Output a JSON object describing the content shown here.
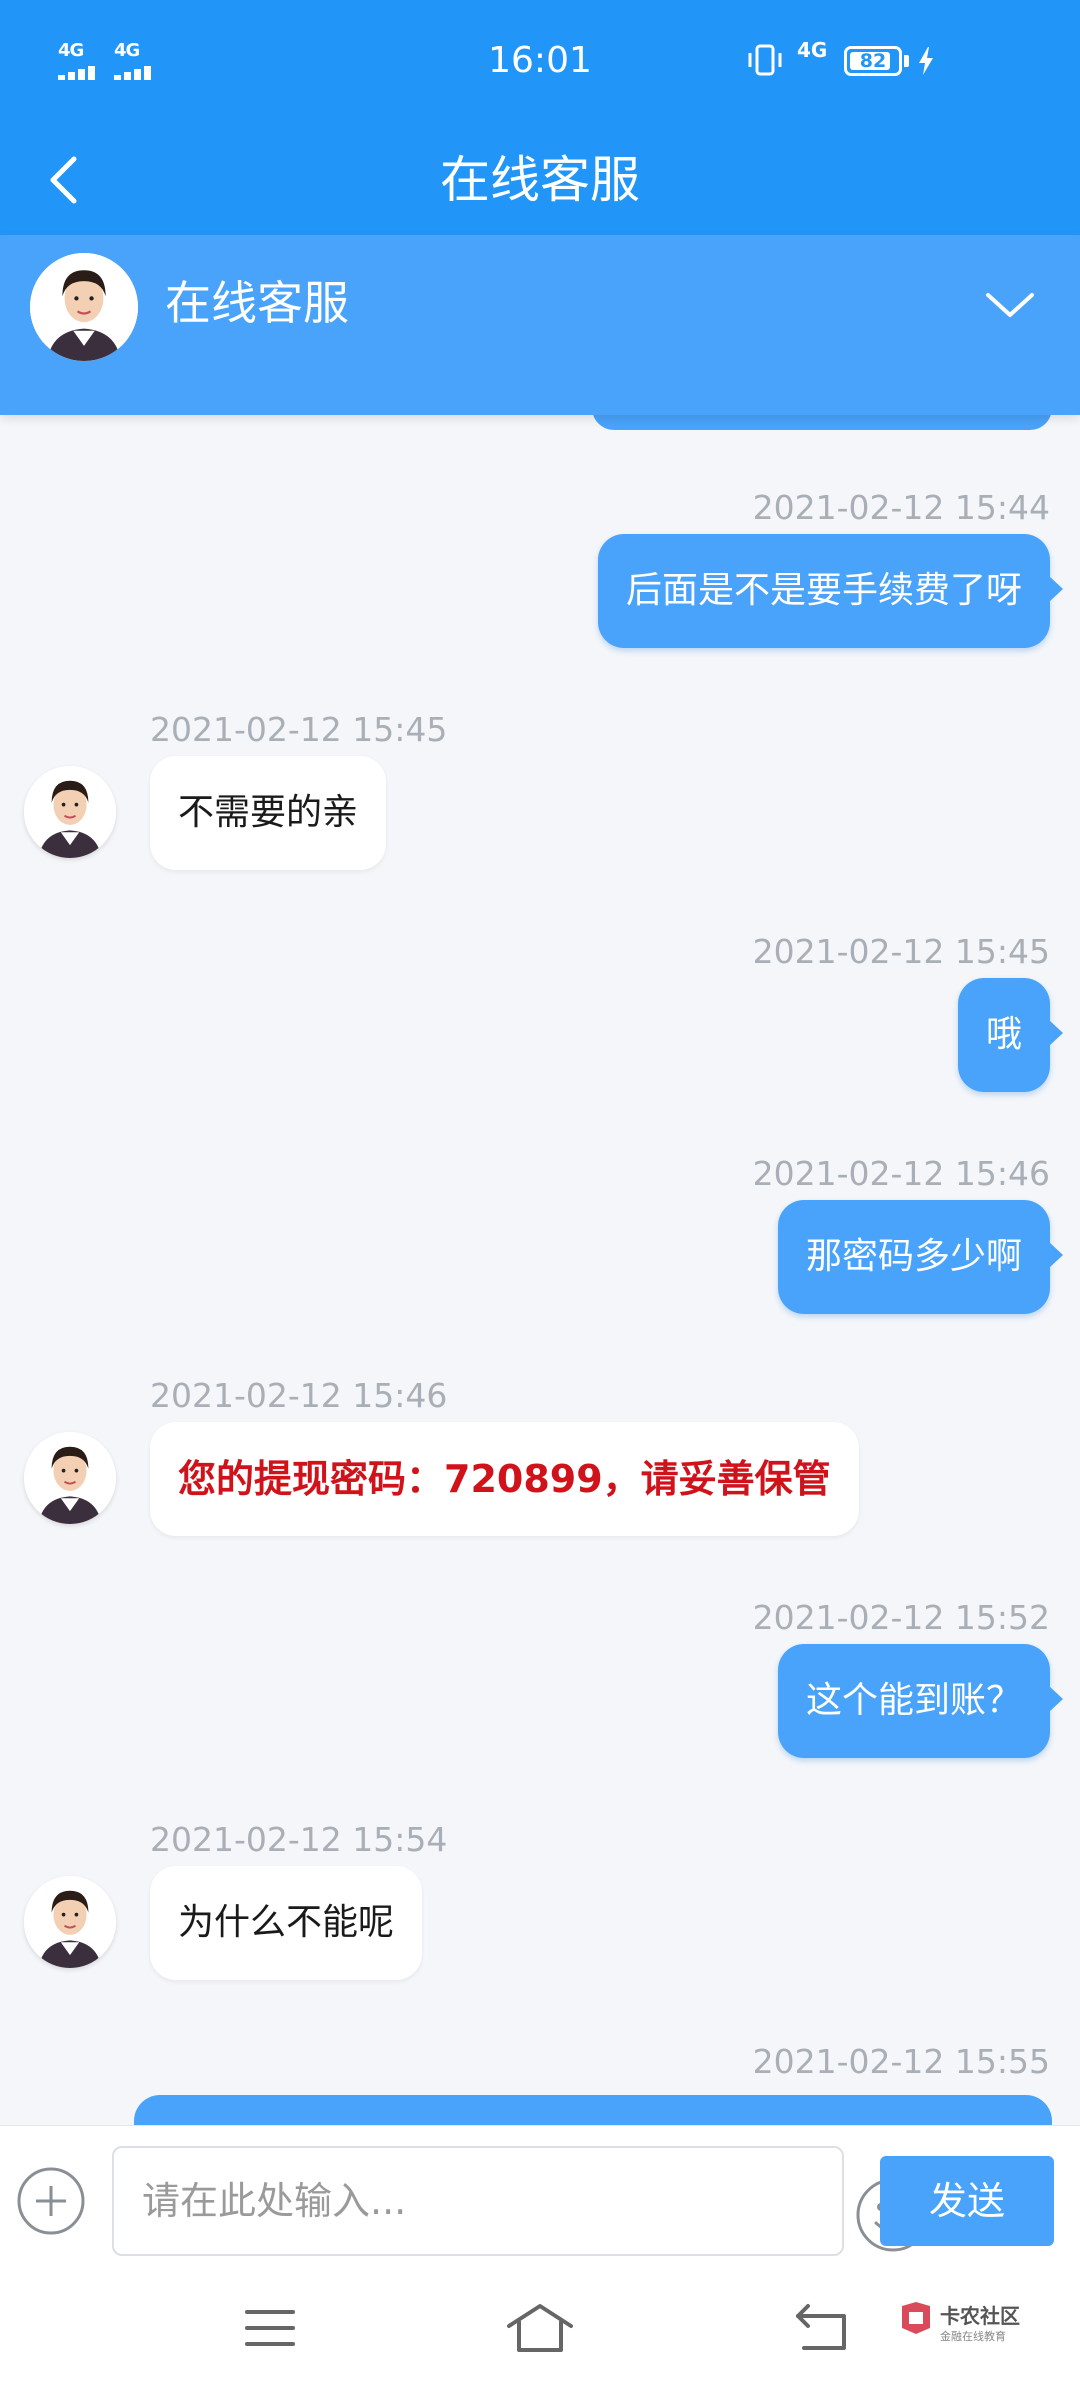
{
  "status_bar": {
    "time": "16:01",
    "sim1_network": "4G",
    "sim2_network": "4G",
    "right_network": "4G",
    "battery_level": "82",
    "icons": [
      "signal-icon",
      "vibrate-icon",
      "battery-icon",
      "charging-icon"
    ]
  },
  "header": {
    "title": "在线客服",
    "back_icon": "back-arrow-icon"
  },
  "agent": {
    "name": "在线客服",
    "expand_icon": "chevron-down-icon"
  },
  "messages": [
    {
      "side": "out",
      "time": "2021-02-12 15:44",
      "text": "后面是不是要手续费了呀"
    },
    {
      "side": "in",
      "time": "2021-02-12 15:45",
      "text": "不需要的亲"
    },
    {
      "side": "out",
      "time": "2021-02-12 15:45",
      "text": "哦"
    },
    {
      "side": "out",
      "time": "2021-02-12 15:46",
      "text": "那密码多少啊"
    },
    {
      "side": "in",
      "time": "2021-02-12 15:46",
      "text": "您的提现密码：720899，请妥善保管",
      "highlight": true
    },
    {
      "side": "out",
      "time": "2021-02-12 15:52",
      "text": "这个能到账？"
    },
    {
      "side": "in",
      "time": "2021-02-12 15:54",
      "text": "为什么不能呢"
    },
    {
      "side": "out",
      "time": "2021-02-12 15:55",
      "text": ""
    }
  ],
  "composer": {
    "placeholder": "请在此处输入...",
    "send_label": "发送",
    "plus_icon": "plus-circle-icon",
    "emoji_icon": "smiley-icon"
  },
  "nav": {
    "icons": [
      "menu-icon",
      "home-icon",
      "back-icon"
    ]
  },
  "watermark": {
    "title": "卡农社区",
    "subtitle": "金融在线教育"
  },
  "colors": {
    "primary": "#2196f8",
    "bubble_out": "#4aa3fa",
    "alert_text": "#d0121b",
    "background": "#f4f6fa"
  }
}
